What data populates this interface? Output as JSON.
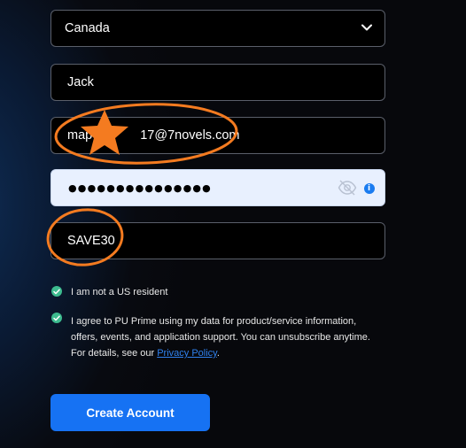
{
  "form": {
    "country": "Canada",
    "first_name": "Jack",
    "email_visible": "map",
    "email_visible_end": "17@7novels.com",
    "password_masked": "●●●●●●●●●●●●●●●",
    "promo_code": "SAVE30",
    "us_resident_label": "I am not a US resident",
    "agree_text": "I agree to PU Prime using my data for product/service information, offers, events, and application support. You can unsubscribe anytime. For details, see our",
    "privacy_link": "Privacy Policy",
    "agree_end": ".",
    "submit_label": "Create Account"
  },
  "colors": {
    "accent": "#1672f3",
    "check": "#3dbb8f",
    "annotation": "#f47b20"
  }
}
